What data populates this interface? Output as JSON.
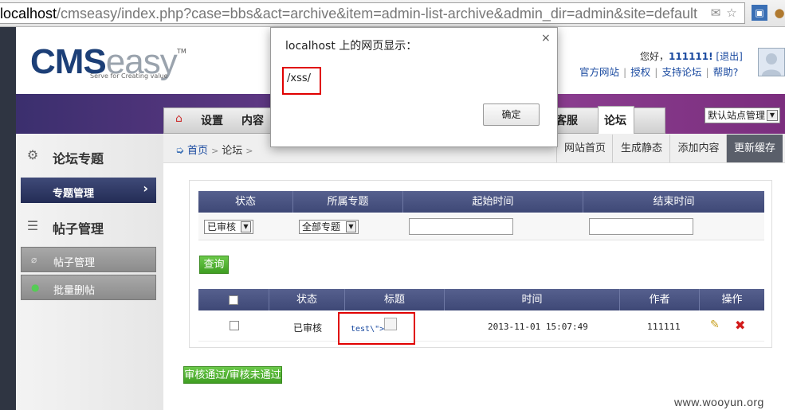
{
  "browser": {
    "url_host": "localhost",
    "url_path": "/cmseasy/index.php?case=bbs&act=archive&item=admin-list-archive&admin_dir=admin&site=default"
  },
  "header": {
    "logo_main": "CMS",
    "logo_secondary": "easy",
    "logo_tm": "TM",
    "logo_tagline": "Serve for Creating value",
    "greeting": "您好，",
    "username": "111111!",
    "logout": "[退出]",
    "links": [
      "官方网站",
      "授权",
      "支持论坛",
      "帮助?"
    ]
  },
  "nav": {
    "items": [
      "设置",
      "内容",
      "客服",
      "论坛"
    ],
    "active": "论坛",
    "site_select": "默认站点管理"
  },
  "sidebar": {
    "section1_title": "论坛专题",
    "section1_active_item": "专题管理",
    "section2_title": "帖子管理",
    "section2_items": [
      "帖子管理",
      "批量删帖"
    ]
  },
  "breadcrumb": {
    "home": "首页",
    "current": "论坛",
    "buttons": [
      "网站首页",
      "生成静态",
      "添加内容",
      "更新缓存"
    ]
  },
  "filter": {
    "headers": [
      "状态",
      "所属专题",
      "起始时间",
      "结束时间"
    ],
    "status_value": "已审核",
    "topic_value": "全部专题",
    "start_time": "",
    "end_time": "",
    "search_button": "查询"
  },
  "table": {
    "headers": [
      "状态",
      "标题",
      "时间",
      "作者",
      "操作"
    ],
    "rows": [
      {
        "status": "已审核",
        "title": "test\\\">",
        "time": "2013-11-01 15:07:49",
        "author": "111111"
      }
    ]
  },
  "bulk_button": "审核通过/审核未通过",
  "watermark": "www.wooyun.org",
  "dialog": {
    "title": "localhost 上的网页显示：",
    "message": "/xss/",
    "ok_label": "确定",
    "close_glyph": "×"
  },
  "colors": {
    "highlight": "#e00000",
    "nav_band": "#6a3a8a",
    "table_header": "#4a5482",
    "green_button": "#4fae2d"
  }
}
